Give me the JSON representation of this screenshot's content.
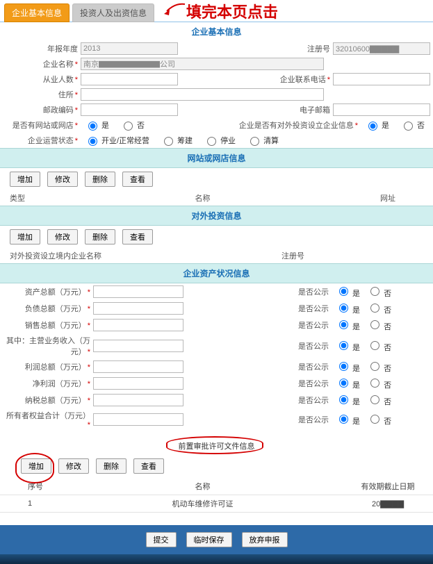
{
  "annotation": "填完本页点击",
  "tabs": {
    "basic": "企业基本信息",
    "investor": "投资人及出资信息"
  },
  "sections": {
    "basic": "企业基本信息",
    "website": "网站或网店信息",
    "outbound": "对外投资信息",
    "assets": "企业资产状况信息",
    "permit": "前置审批许可文件信息"
  },
  "labels": {
    "year": "年报年度",
    "regno": "注册号",
    "name": "企业名称",
    "employees": "从业人数",
    "contact_phone": "企业联系电话",
    "address": "住所",
    "zip": "邮政编码",
    "email": "电子邮箱",
    "has_site": "是否有网站或网店",
    "has_outinvest": "企业是否有对外投资设立企业信息",
    "op_status": "企业运营状态",
    "outinvest_target": "对外投资设立境内企业名称",
    "outinvest_regno": "注册号"
  },
  "values": {
    "year": "2013",
    "regno": "32010600▇▇▇▇▇",
    "name": "南京▇▇▇▇▇▇▇▇公司"
  },
  "radios": {
    "yes": "是",
    "no": "否",
    "op_open": "开业/正常经营",
    "op_prep": "筹建",
    "op_stop": "停业",
    "op_clear": "清算"
  },
  "buttons": {
    "add": "增加",
    "edit": "修改",
    "del": "删除",
    "view": "查看",
    "submit": "提交",
    "draft": "临时保存",
    "giveup": "放弃申报"
  },
  "site_cols": {
    "type": "类型",
    "name": "名称",
    "url": "网址"
  },
  "outinvest_cols": {
    "name": "对外投资设立境内企业名称",
    "regno": "注册号"
  },
  "assets": [
    {
      "label": "资产总额（万元）",
      "pub_label": "是否公示"
    },
    {
      "label": "负债总额（万元）",
      "pub_label": "是否公示"
    },
    {
      "label": "销售总额（万元）",
      "pub_label": "是否公示"
    },
    {
      "label": "其中：主营业务收入（万元）",
      "pub_label": "是否公示"
    },
    {
      "label": "利润总额（万元）",
      "pub_label": "是否公示"
    },
    {
      "label": "净利润（万元）",
      "pub_label": "是否公示"
    },
    {
      "label": "纳税总额（万元）",
      "pub_label": "是否公示"
    },
    {
      "label": "所有者权益合计（万元）",
      "pub_label": "是否公示"
    }
  ],
  "permit_cols": {
    "seq": "序号",
    "name": "名称",
    "expiry": "有效期截止日期"
  },
  "permit_rows": [
    {
      "seq": "1",
      "name": "机动车维修许可证",
      "expiry": "20▇▇▇▇"
    }
  ]
}
